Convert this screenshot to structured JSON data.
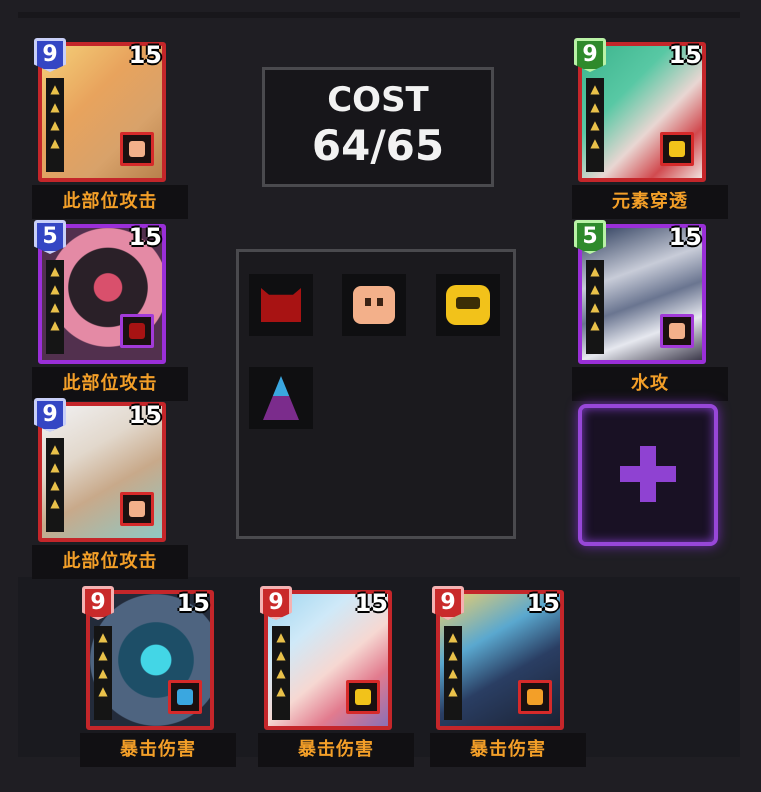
{
  "cost": {
    "label": "COST",
    "value": "64/65"
  },
  "add_button": {
    "icon": "plus-icon"
  },
  "elements": [
    {
      "name": "devil",
      "color": "#a81313"
    },
    {
      "name": "face",
      "color": "#f3b08a"
    },
    {
      "name": "tiger",
      "color": "#f2c21a"
    },
    {
      "name": "wizard",
      "color": "#3aa7e0"
    }
  ],
  "cards": [
    {
      "id": "left1",
      "level": "9",
      "count": "15",
      "label": "此部位攻击",
      "level_color": "blue",
      "frame": "gold",
      "portrait": "blonde-hero"
    },
    {
      "id": "left2",
      "level": "5",
      "count": "15",
      "label": "此部位攻击",
      "level_color": "blue",
      "frame": "purple",
      "portrait": "hooded-pink"
    },
    {
      "id": "left3",
      "level": "9",
      "count": "15",
      "label": "此部位攻击",
      "level_color": "blue",
      "frame": "gold",
      "portrait": "white-hair"
    },
    {
      "id": "right1",
      "level": "9",
      "count": "15",
      "label": "元素穿透",
      "level_color": "green",
      "frame": "gold",
      "portrait": "green-hair"
    },
    {
      "id": "right2",
      "level": "5",
      "count": "15",
      "label": "水攻",
      "level_color": "green",
      "frame": "purple",
      "portrait": "white-beast"
    },
    {
      "id": "bottom1",
      "level": "9",
      "count": "15",
      "label": "暴击伤害",
      "level_color": "red",
      "frame": "gold",
      "portrait": "hooded-blue"
    },
    {
      "id": "bottom2",
      "level": "9",
      "count": "15",
      "label": "暴击伤害",
      "level_color": "red",
      "frame": "gold",
      "portrait": "pastel-hair"
    },
    {
      "id": "bottom3",
      "level": "9",
      "count": "15",
      "label": "暴击伤害",
      "level_color": "red",
      "frame": "gold",
      "portrait": "dark-wolf"
    }
  ]
}
